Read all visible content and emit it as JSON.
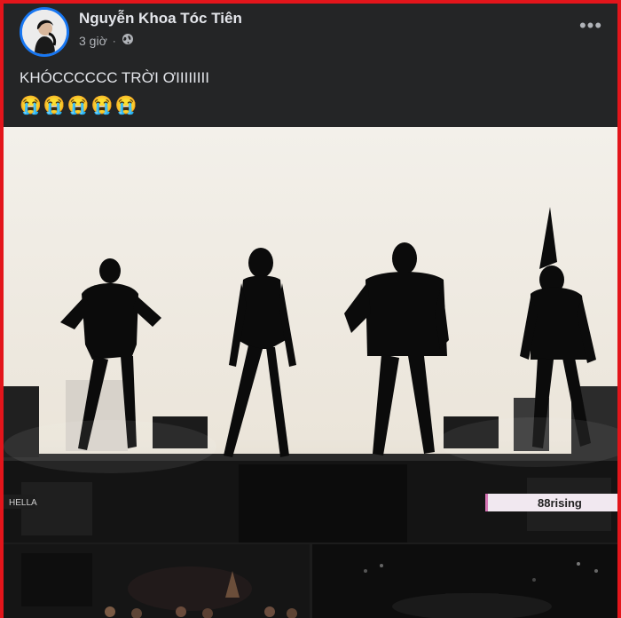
{
  "post": {
    "author": "Nguyễn Khoa Tóc Tiên",
    "time": "3 giờ",
    "privacy_icon": "globe-icon",
    "more_label": "•••",
    "caption": "KHÓCCCCCC TRỜI ƠIIIIIIII",
    "emojis": "😭😭😭😭😭"
  },
  "media": {
    "left_watermark": "HELLA",
    "right_watermark": "88rising"
  },
  "colors": {
    "frame_border": "#e3151b",
    "post_bg": "#242526",
    "name_text": "#e4e6eb",
    "meta_text": "#b0b3b8",
    "avatar_ring": "#1877f2"
  }
}
